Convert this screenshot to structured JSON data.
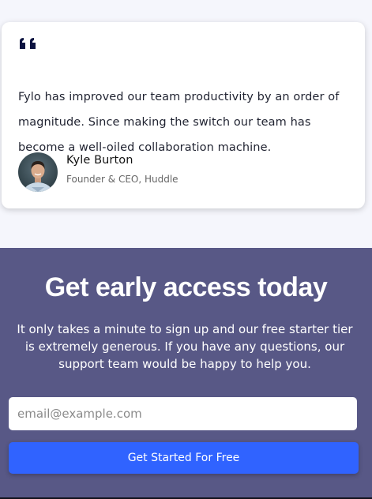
{
  "testimonial": {
    "quote_icon": "quote-icon",
    "text": "Fylo has improved our team productivity by an order of magnitude. Since making the switch our team has become a well-oiled collaboration machine.",
    "author": {
      "name": "Kyle Burton",
      "role": "Founder & CEO, Huddle",
      "avatar_icon": "avatar"
    }
  },
  "cta": {
    "title": "Get early access today",
    "body": "It only takes a minute to sign up and our free starter tier is extremely generous. If you have any questions, our support team would be happy to help you.",
    "email_placeholder": "email@example.com",
    "button_label": "Get Started For Free"
  },
  "colors": {
    "page_background": "#f5f6fc",
    "cta_background": "#585886",
    "button_blue": "#3063ff",
    "quote_navy": "#0c1340"
  }
}
